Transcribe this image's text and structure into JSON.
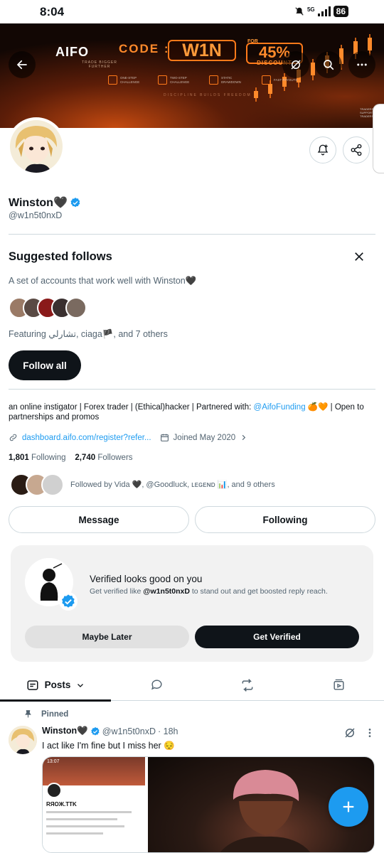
{
  "status_bar": {
    "time": "8:04",
    "network": "5G",
    "battery": "86"
  },
  "banner": {
    "logo": "AIFO",
    "logo_tagline": "TRADE BIGGER FURTHER",
    "code_label": "CODE :",
    "code": "W1N",
    "for_label": "FOR",
    "discount_pct": "45%",
    "discount_word": "DISCOUNT",
    "features": [
      "ONE-STEP CHALLENGE",
      "TWO-STEP CHALLENGE",
      "STATIC DRAWDOWN",
      "FAST PAYOUTS"
    ],
    "tagline": "DISCIPLINE BUILDS FREEDOM",
    "side_text": "TRADERS SUPPORTING TRADERS"
  },
  "profile": {
    "name": "Winston🖤",
    "handle": "@w1n5t0nxD"
  },
  "suggested": {
    "title": "Suggested follows",
    "description": "A set of accounts that work well with Winston🖤",
    "featuring": "Featuring تشارلي, ciaga🏴, and 7 others",
    "follow_all": "Follow all",
    "face_colors": [
      "#9a7a66",
      "#5a4a44",
      "#8a1a1a",
      "#3a3030",
      "#7a6a60"
    ]
  },
  "bio": {
    "text_before": "an online instigator | Forex trader | (Ethical)hacker | Partnered with: ",
    "mention": "@AifoFunding",
    "text_after": " 🍊🧡 | Open to partnerships and promos",
    "link": "dashboard.aifo.com/register?refer...",
    "joined": "Joined May 2020",
    "following_count": "1,801",
    "following_label": "Following",
    "followers_count": "2,740",
    "followers_label": "Followers",
    "followed_by": "Followed by Vida 🖤, @Goodluck, ʟᴇɢᴇɴᴅ 📊, and 9 others"
  },
  "actions": {
    "message": "Message",
    "following": "Following"
  },
  "verified_card": {
    "title": "Verified looks good on you",
    "subtitle_before": "Get verified like ",
    "subtitle_handle": "@w1n5t0nxD",
    "subtitle_after": " to stand out and get boosted reply reach.",
    "maybe_later": "Maybe Later",
    "get_verified": "Get Verified"
  },
  "tabs": {
    "posts": "Posts"
  },
  "post": {
    "pinned_label": "Pinned",
    "name": "Winston🖤",
    "handle": "@w1n5t0nxD",
    "time": "· 18h",
    "text": "I act like I'm fine but I miss her 😔",
    "thumb_name": "RЯOЖ.TTK",
    "thumb_time": "13:07"
  },
  "colors": {
    "accent": "#1d9bf0",
    "dark": "#0f1419",
    "muted": "#536471",
    "banner_orange": "#ff7a1a"
  }
}
